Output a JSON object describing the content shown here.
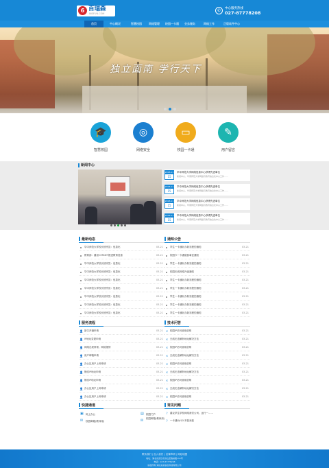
{
  "header": {
    "logo_text": "百瑞森",
    "logo_sub": "INSFUN.COM",
    "logo_mark": "6",
    "hotline_label": "中心服务热线",
    "hotline_number": "027-87778208"
  },
  "nav": {
    "items": [
      {
        "label": "首页"
      },
      {
        "label": "中心概况"
      },
      {
        "label": "智慧校园"
      },
      {
        "label": "网络管理"
      },
      {
        "label": "校园一卡通"
      },
      {
        "label": "业务服务"
      },
      {
        "label": "网络工作"
      },
      {
        "label": "正版软件中心"
      }
    ]
  },
  "banner": {
    "slogan": "独立面南 学行天下"
  },
  "features": [
    {
      "label": "智慧校园",
      "icon": "graduation-cap-icon",
      "glyph": "🎓",
      "color": "#1aa3d8"
    },
    {
      "label": "网络安全",
      "icon": "globe-icon",
      "glyph": "◎",
      "color": "#1b7fd0"
    },
    {
      "label": "校园一卡通",
      "icon": "card-icon",
      "glyph": "▭",
      "color": "#f0ab1c"
    },
    {
      "label": "用户留言",
      "icon": "message-icon",
      "glyph": "✎",
      "color": "#1db5b0"
    }
  ],
  "news": {
    "title": "新闻中心",
    "items": [
      {
        "month": "2018-11",
        "day": "15",
        "title": "华中师范大学网络信息中心获得先进单位",
        "summary": "新闻中心，华南师范大学网络与教育信息化中心工作……"
      },
      {
        "month": "2018-11",
        "day": "15",
        "title": "华中师范大学网络信息中心获得先进单位",
        "summary": "新闻中心，华南师范大学网络与教育信息化中心工作……"
      },
      {
        "month": "2018-11",
        "day": "15",
        "title": "华中师范大学网络信息中心获得先进单位",
        "summary": "新闻中心，华南师范大学网络与教育信息化中心工作……"
      },
      {
        "month": "2018-11",
        "day": "15",
        "title": "华中师范大学网络信息中心获得先进单位",
        "summary": "新闻中心，华南师范大学网络与教育信息化中心工作……"
      }
    ]
  },
  "panels": {
    "latest": {
      "title": "最新动态",
      "rows": [
        {
          "text": "华中师范大学校长杨宗凯：信息化",
          "date": "03-21"
        },
        {
          "text": "教育部：建设CERNET推进教育信息",
          "date": "03-21"
        },
        {
          "text": "华中师范大学校长杨宗凯：信息化",
          "date": "03-21"
        },
        {
          "text": "华中师范大学校长杨宗凯：信息化",
          "date": "03-21"
        },
        {
          "text": "华中师范大学校长杨宗凯：信息化",
          "date": "03-21"
        },
        {
          "text": "华中师范大学校长杨宗凯：信息化",
          "date": "03-21"
        },
        {
          "text": "华中师范大学校长杨宗凯：信息化",
          "date": "03-21"
        },
        {
          "text": "华中师范大学校长杨宗凯：信息化",
          "date": "03-21"
        },
        {
          "text": "华中师范大学校长杨宗凯：信息化",
          "date": "03-21"
        }
      ]
    },
    "notice": {
      "title": "通知公告",
      "rows": [
        {
          "text": "学生一卡通补办新流程的通知",
          "date": "03-21"
        },
        {
          "text": "校园卡一卡通缴费事宜通知",
          "date": "03-21"
        },
        {
          "text": "学生一卡通补办新流程的通知",
          "date": "03-21"
        },
        {
          "text": "校园无线网络升级通知",
          "date": "03-21"
        },
        {
          "text": "学生一卡通补办新流程的通知",
          "date": "03-21"
        },
        {
          "text": "学生一卡通补办新流程的通知",
          "date": "03-21"
        },
        {
          "text": "学生一卡通补办新流程的通知",
          "date": "03-21"
        },
        {
          "text": "学生一卡通补办新流程的通知",
          "date": "03-21"
        },
        {
          "text": "学生一卡通补办新流程的通知",
          "date": "03-21"
        }
      ]
    },
    "service": {
      "title": "服务流程",
      "rows": [
        {
          "text": "新口开通申请",
          "date": "03-21"
        },
        {
          "text": "IP地址变更申请",
          "date": "03-21"
        },
        {
          "text": "网络出现异常、网络报修",
          "date": "03-21"
        },
        {
          "text": "用户邮箱申请",
          "date": "03-21"
        },
        {
          "text": "办公区用户上网申请",
          "date": "03-21"
        },
        {
          "text": "静态IP地址申请",
          "date": "03-21"
        },
        {
          "text": "静态IP地址申请",
          "date": "03-21"
        },
        {
          "text": "办公区用户上网申请",
          "date": "03-21"
        },
        {
          "text": "办公区用户上网申请",
          "date": "03-21"
        }
      ]
    },
    "tech": {
      "title": "技术问答",
      "rows": [
        {
          "text": "校园IP访问使用说明",
          "date": "03-21"
        },
        {
          "text": "无线无法解析地址解决方法",
          "date": "03-21"
        },
        {
          "text": "校园IP访问使用说明",
          "date": "03-21"
        },
        {
          "text": "无线无法解析地址解决方法",
          "date": "03-21"
        },
        {
          "text": "校园IP访问使用说明",
          "date": "03-21"
        },
        {
          "text": "无线无法解析地址解决方法",
          "date": "03-21"
        },
        {
          "text": "校园IP访问使用说明",
          "date": "03-21"
        },
        {
          "text": "无线无法解析地址解决方法",
          "date": "03-21"
        },
        {
          "text": "校园IP访问使用说明",
          "date": "03-21"
        }
      ]
    },
    "quick": {
      "title": "快捷通道",
      "links": [
        {
          "label": "网上办公"
        },
        {
          "label": "校园门户"
        },
        {
          "label": "校园邮箱(教师用)"
        },
        {
          "label": "校园邮箱(教师用)"
        }
      ]
    },
    "faq": {
      "title": "常见问题",
      "rows": [
        {
          "text": "建议学生学校网络我们公司，运行一……"
        },
        {
          "text": "一卡通为什么不能消费"
        }
      ]
    }
  },
  "footer": {
    "links": "联系我们  |  加入我们  |  法律声明  |  网站地图",
    "address": "地址：湖北省武汉市洪山区珞喻路152号",
    "contact": "电话：027-87778208",
    "copyright": "版权所有 湖北某某信息科技有限公司"
  }
}
